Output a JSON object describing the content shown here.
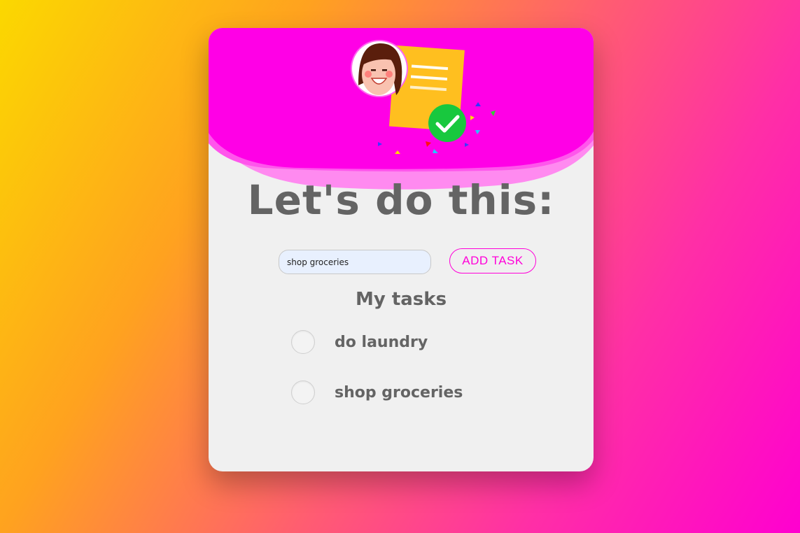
{
  "header": {
    "illustration": "woman-avatar-with-checklist-note-icon",
    "check_icon": "checkmark-icon"
  },
  "title": "Let's do this:",
  "form": {
    "input_value": "shop groceries",
    "button_label": "ADD TASK"
  },
  "tasks_section": {
    "heading": "My tasks",
    "items": [
      {
        "label": "do laundry",
        "completed": false
      },
      {
        "label": "shop groceries",
        "completed": false
      }
    ]
  },
  "colors": {
    "accent": "#ff00d9",
    "header": "#ff00e6",
    "check_green": "#18c83e",
    "note_yellow": "#ffbf1f",
    "text_gray": "#646464",
    "card_bg": "#f0f0f0"
  }
}
